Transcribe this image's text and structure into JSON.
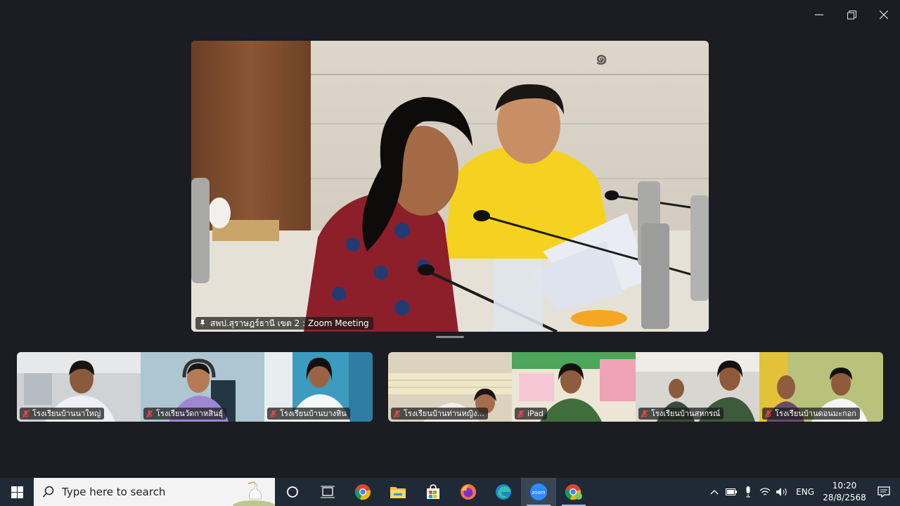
{
  "main_video": {
    "label": "สพป.สุราษฎร์ธานี เขต 2 : Zoom Meeting",
    "sign_text": "๑"
  },
  "participants_left": [
    {
      "label": "โรงเรียนบ้านนาใหญ่"
    },
    {
      "label": "โรงเรียนวัดกาหสินธุ์"
    },
    {
      "label": "โรงเรียนบ้านบางหิน"
    }
  ],
  "participants_right": [
    {
      "label": "โรงเรียนบ้านท่านหญิง..."
    },
    {
      "label": "iPad"
    },
    {
      "label": "โรงเรียนบ้านสหกรณ์"
    },
    {
      "label": "โรงเรียนบ้านดอนมะกอก"
    }
  ],
  "taskbar": {
    "search_placeholder": "Type here to search",
    "zoom_icon_text": "zoom",
    "language": "ENG",
    "time": "10:20",
    "date": "28/8/2568"
  },
  "colors": {
    "background": "#1b1d22",
    "taskbar": "#1f2a36",
    "muted_red": "#e04848"
  }
}
